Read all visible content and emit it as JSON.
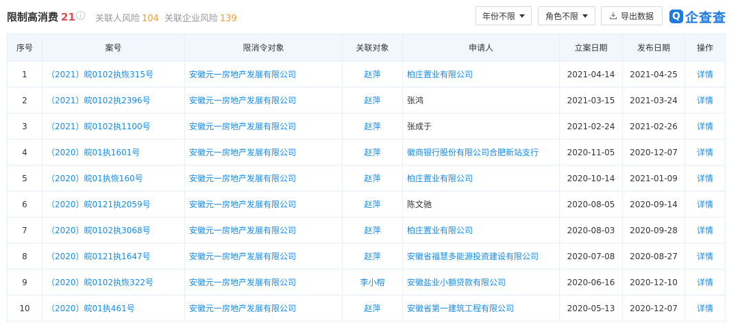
{
  "header": {
    "title": "限制高消费",
    "title_count": "21",
    "info_icon": "i",
    "related_person_label": "关联人风险",
    "related_person_count": "104",
    "related_company_label": "关联企业风险",
    "related_company_count": "139",
    "year_filter": "年份不限",
    "role_filter": "角色不限",
    "export_label": "导出数据",
    "logo_mark": "Q",
    "logo_text": "企查查"
  },
  "colors": {
    "link": "#128bed",
    "count_red": "#e5484d",
    "count_orange": "#f0a020",
    "header_bg": "#f2f7fd",
    "brand": "#1f7ae0"
  },
  "table": {
    "columns": [
      "序号",
      "案号",
      "限消令对象",
      "关联对象",
      "申请人",
      "立案日期",
      "发布日期",
      "操作"
    ],
    "rows": [
      {
        "no": "1",
        "case": "（2021）皖0102执恢315号",
        "target": "安徽元一房地产发展有限公司",
        "related": "赵萍",
        "applicant": "柏庄置业有限公司",
        "applicant_link": true,
        "filed": "2021-04-14",
        "published": "2021-04-25",
        "action": "详情"
      },
      {
        "no": "2",
        "case": "（2021）皖0102执2396号",
        "target": "安徽元一房地产发展有限公司",
        "related": "赵萍",
        "applicant": "张鸿",
        "applicant_link": false,
        "filed": "2021-03-15",
        "published": "2021-03-24",
        "action": "详情"
      },
      {
        "no": "3",
        "case": "（2021）皖0102执1100号",
        "target": "安徽元一房地产发展有限公司",
        "related": "赵萍",
        "applicant": "张成于",
        "applicant_link": false,
        "filed": "2021-02-24",
        "published": "2021-02-26",
        "action": "详情"
      },
      {
        "no": "4",
        "case": "（2020）皖01执1601号",
        "target": "安徽元一房地产发展有限公司",
        "related": "赵萍",
        "applicant": "徽商银行股份有限公司合肥新站支行",
        "applicant_link": true,
        "filed": "2020-11-05",
        "published": "2020-12-07",
        "action": "详情"
      },
      {
        "no": "5",
        "case": "（2020）皖01执恢160号",
        "target": "安徽元一房地产发展有限公司",
        "related": "赵萍",
        "applicant": "柏庄置业有限公司",
        "applicant_link": true,
        "filed": "2020-10-14",
        "published": "2021-01-09",
        "action": "详情"
      },
      {
        "no": "6",
        "case": "（2020）皖0121执2059号",
        "target": "安徽元一房地产发展有限公司",
        "related": "赵萍",
        "applicant": "陈文驰",
        "applicant_link": false,
        "filed": "2020-08-05",
        "published": "2020-09-14",
        "action": "详情"
      },
      {
        "no": "7",
        "case": "（2020）皖0102执3068号",
        "target": "安徽元一房地产发展有限公司",
        "related": "赵萍",
        "applicant": "柏庄置业有限公司",
        "applicant_link": true,
        "filed": "2020-08-03",
        "published": "2020-09-28",
        "action": "详情"
      },
      {
        "no": "8",
        "case": "（2020）皖0121执1647号",
        "target": "安徽元一房地产发展有限公司",
        "related": "赵萍",
        "applicant": "安徽省福慧多能源投资建设有限公司",
        "applicant_link": true,
        "filed": "2020-07-08",
        "published": "2020-08-27",
        "action": "详情"
      },
      {
        "no": "9",
        "case": "（2020）皖0102执恢322号",
        "target": "安徽元一房地产发展有限公司",
        "related": "李小榕",
        "applicant": "安徽盐业小额贷款有限公司",
        "applicant_link": true,
        "filed": "2020-06-16",
        "published": "2020-12-10",
        "action": "详情"
      },
      {
        "no": "10",
        "case": "（2020）皖01执461号",
        "target": "安徽元一房地产发展有限公司",
        "related": "赵萍",
        "applicant": "安徽省第一建筑工程有限公司",
        "applicant_link": true,
        "filed": "2020-05-13",
        "published": "2020-12-07",
        "action": "详情"
      }
    ]
  }
}
